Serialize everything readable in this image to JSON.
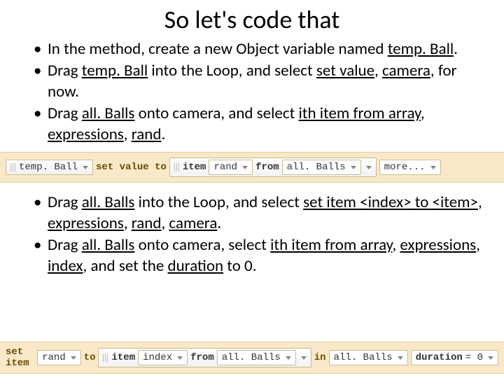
{
  "title": "So let's code that",
  "bullets1": [
    {
      "text_pre": "In the method, create a new Object variable named ",
      "u1": "temp. Ball",
      "text_post": "."
    },
    {
      "text_pre": "Drag ",
      "u1": "temp. Ball",
      "mid": " into the Loop, and select ",
      "u2": "set value",
      "mid2": ", ",
      "u3": "camera",
      "text_post": ", for now."
    },
    {
      "text_pre": "Drag ",
      "u1": "all. Balls",
      "mid": " onto camera, and select ",
      "u2": "ith item from array",
      "mid2": ", ",
      "u3": "expressions",
      "mid3": ", ",
      "u4": "rand",
      "text_post": "."
    }
  ],
  "codebar1": {
    "t1": "temp. Ball",
    "w1": "set value to",
    "t2": "item",
    "t3": "rand",
    "w2": "from",
    "t4": "all. Balls",
    "t5": "more..."
  },
  "bullets2": [
    {
      "text_pre": "Drag ",
      "u1": "all. Balls",
      "mid": " into the Loop, and select ",
      "u2": "set item <index> to <item>",
      "mid2": ", ",
      "u3": "expressions",
      "mid3": ", ",
      "u4": "rand",
      "mid4": ", ",
      "u5": "camera",
      "text_post": "."
    },
    {
      "text_pre": "Drag ",
      "u1": "all. Balls",
      "mid": " onto camera, select ",
      "u2": "ith item from array",
      "mid2": ", ",
      "u3": "expressions",
      "mid3": ", ",
      "u4": "index",
      "mid4": ", and set the ",
      "u5": "duration",
      "text_post": " to 0."
    }
  ],
  "codebar2": {
    "w1": "set item",
    "t1": "rand",
    "w2": "to",
    "t2": "item",
    "t3": "index",
    "w3": "from",
    "t4": "all. Balls",
    "w4": "in",
    "t5": "all. Balls",
    "w5": "duration",
    "eq": "= 0"
  }
}
